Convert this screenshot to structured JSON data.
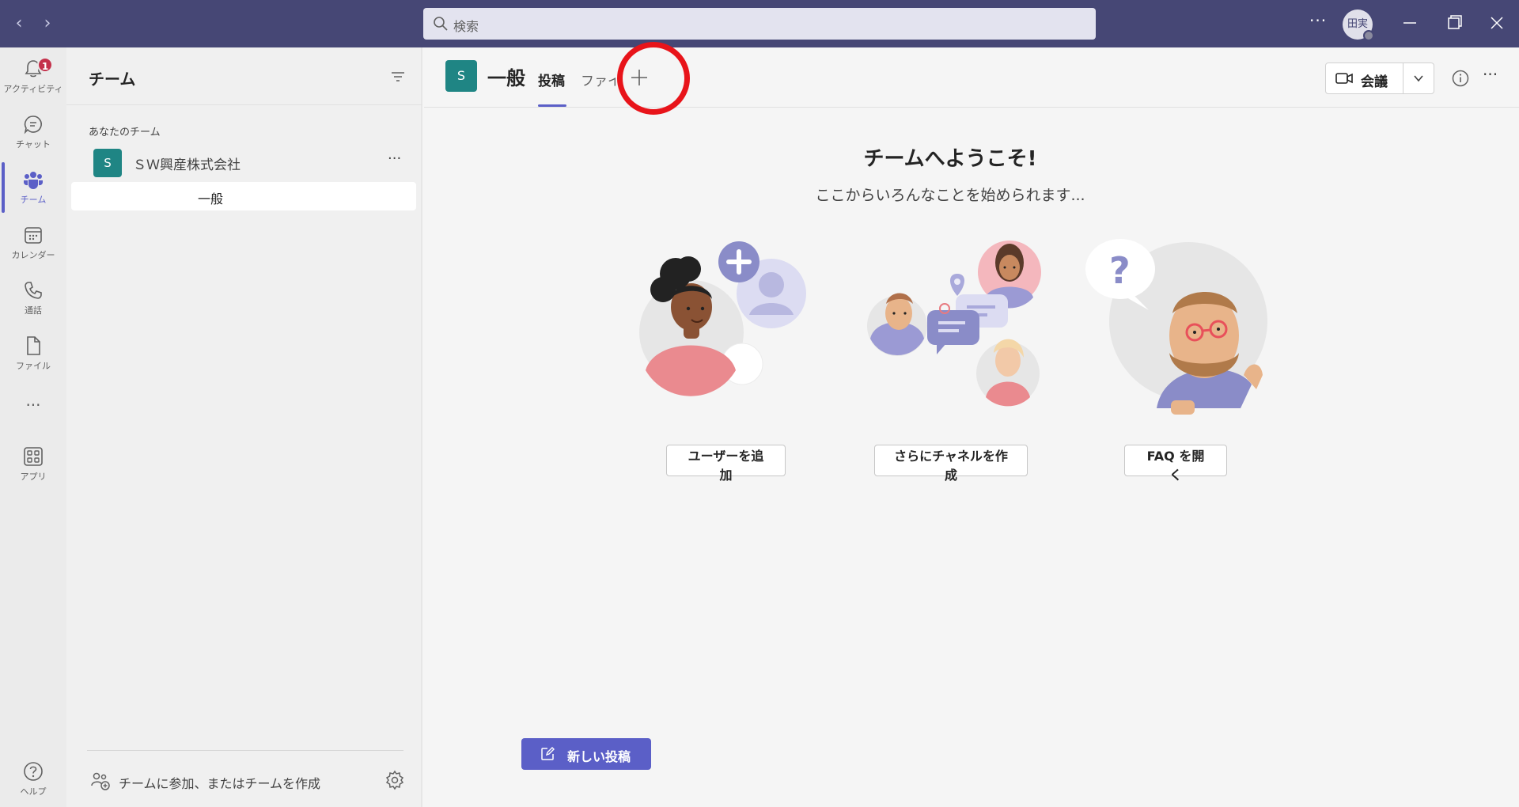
{
  "titlebar": {
    "search_placeholder": "検索",
    "user_initials": "田実"
  },
  "rail": {
    "items": [
      {
        "label": "アクティビティ",
        "icon": "bell-icon",
        "badge": "1"
      },
      {
        "label": "チャット",
        "icon": "chat-icon"
      },
      {
        "label": "チーム",
        "icon": "teams-icon",
        "active": true
      },
      {
        "label": "カレンダー",
        "icon": "calendar-icon"
      },
      {
        "label": "通話",
        "icon": "phone-icon"
      },
      {
        "label": "ファイル",
        "icon": "file-icon"
      },
      {
        "label": "アプリ",
        "icon": "apps-icon"
      },
      {
        "label": "ヘルプ",
        "icon": "help-icon"
      }
    ],
    "more": "···"
  },
  "teams_panel": {
    "title": "チーム",
    "section_label": "あなたのチーム",
    "team": {
      "avatar": "S",
      "name": "ＳＷ興産株式会社",
      "more": "···"
    },
    "channel": "一般",
    "join_text": "チームに参加、またはチームを作成"
  },
  "channel_header": {
    "avatar": "S",
    "title": "一般",
    "tabs": [
      {
        "label": "投稿",
        "active": true
      },
      {
        "label": "ファイル"
      }
    ],
    "meet_label": "会議",
    "more": "···"
  },
  "welcome": {
    "title": "チームへようこそ!",
    "subtitle": "ここからいろんなことを始められます...",
    "actions": [
      "ユーザーを追加",
      "さらにチャネルを作成",
      "FAQ を開く"
    ]
  },
  "new_post": {
    "label": "新しい投稿"
  },
  "colors": {
    "brand": "#464775",
    "accent": "#5b5fc7",
    "team": "#1f8584",
    "badge": "#c4314b",
    "highlight": "#e8141a"
  }
}
